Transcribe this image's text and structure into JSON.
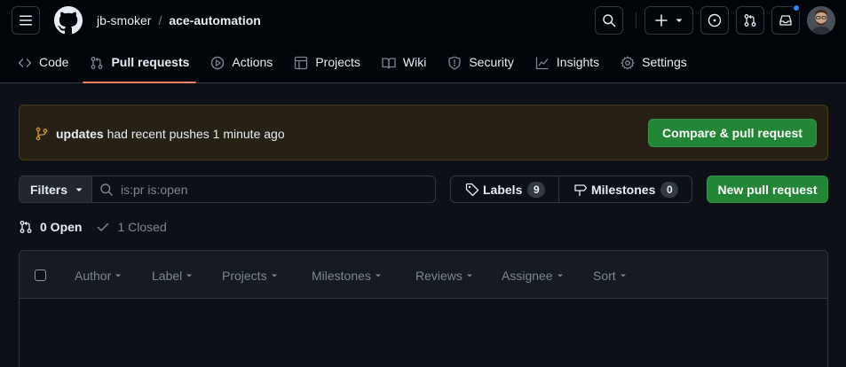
{
  "header": {
    "owner": "jb-smoker",
    "separator": "/",
    "repo": "ace-automation"
  },
  "tabs": [
    {
      "label": "Code",
      "icon": "code-icon"
    },
    {
      "label": "Pull requests",
      "icon": "git-pull-request-icon",
      "selected": true
    },
    {
      "label": "Actions",
      "icon": "play-icon"
    },
    {
      "label": "Projects",
      "icon": "table-icon"
    },
    {
      "label": "Wiki",
      "icon": "book-icon"
    },
    {
      "label": "Security",
      "icon": "shield-icon"
    },
    {
      "label": "Insights",
      "icon": "graph-icon"
    },
    {
      "label": "Settings",
      "icon": "gear-icon"
    }
  ],
  "flash": {
    "branch": "updates",
    "message": "had recent pushes 1 minute ago",
    "compare_button": "Compare & pull request"
  },
  "filters": {
    "button_label": "Filters",
    "search_value": "is:pr is:open"
  },
  "labels": {
    "label": "Labels",
    "count": "9"
  },
  "milestones": {
    "label": "Milestones",
    "count": "0"
  },
  "new_pr_button": "New pull request",
  "states": {
    "open": "0 Open",
    "closed": "1 Closed"
  },
  "list_header": {
    "filters": [
      "Author",
      "Label",
      "Projects",
      "Milestones",
      "Reviews",
      "Assignee",
      "Sort"
    ]
  },
  "colors": {
    "accent_green": "#238636",
    "tab_underline": "#f78166",
    "notification_dot": "#2f81f7",
    "flash_bg": "#272115"
  }
}
